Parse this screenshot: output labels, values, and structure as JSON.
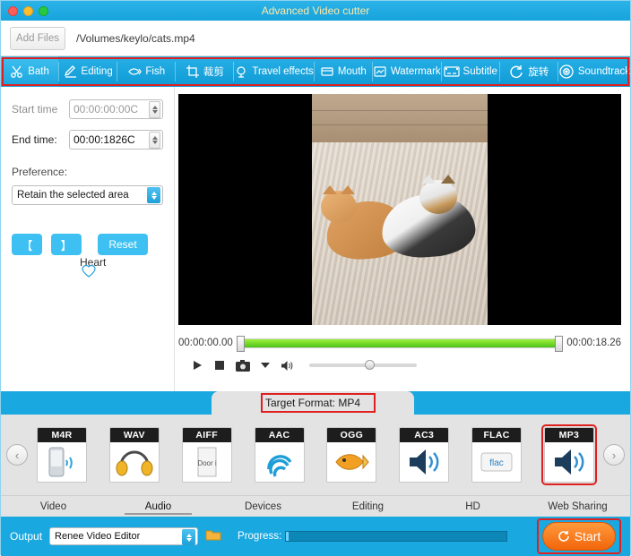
{
  "window": {
    "title": "Advanced Video cutter",
    "traffic_lights": [
      "close",
      "minimize",
      "zoom"
    ]
  },
  "file_row": {
    "add_files_label": "Add Files",
    "file_path": "/Volumes/keylo/cats.mp4"
  },
  "toolbar": {
    "tabs": [
      {
        "label": "Bath",
        "icon": "scissors-icon"
      },
      {
        "label": "Editing",
        "icon": "edit-icon"
      },
      {
        "label": "Fish",
        "icon": "fish-icon"
      },
      {
        "label": "裁剪",
        "icon": "crop-icon"
      },
      {
        "label": "Travel effects",
        "icon": "effects-icon"
      },
      {
        "label": "Mouth",
        "icon": "mouth-icon"
      },
      {
        "label": "Watermark",
        "icon": "watermark-icon"
      },
      {
        "label": "Subtitle",
        "icon": "subtitle-icon"
      },
      {
        "label": "旋转",
        "icon": "rotate-icon"
      },
      {
        "label": "Soundtrack",
        "icon": "soundtrack-icon"
      }
    ]
  },
  "left_panel": {
    "start_time_label": "Start time",
    "start_time_value": "00:00:00:00C",
    "end_time_label": "End time:",
    "end_time_value": "00:00:1826C",
    "preference_label": "Preference:",
    "preference_value": "Retain the selected area",
    "preference_options": [
      "Retain the selected area"
    ],
    "mark_in_label": "【",
    "mark_out_label": "】",
    "reset_label": "Reset",
    "overlay_text": "Heart"
  },
  "player": {
    "current_time": "00:00:00.00",
    "total_time": "00:00:18.26",
    "progress_percent": 100,
    "volume_percent": 52,
    "controls": [
      "play",
      "stop",
      "snapshot",
      "dropdown",
      "volume"
    ]
  },
  "target_format": {
    "label": "Target Format:",
    "value": "MP4"
  },
  "formats": {
    "prev_arrow": "‹",
    "next_arrow": "›",
    "items": [
      {
        "name": "M4R",
        "selected": false,
        "art": "phone-icon"
      },
      {
        "name": "WAV",
        "selected": false,
        "art": "headphones-icon"
      },
      {
        "name": "AIFF",
        "selected": false,
        "art": "door-icon",
        "sub": "Door i"
      },
      {
        "name": "AAC",
        "selected": false,
        "art": "wave-icon"
      },
      {
        "name": "OGG",
        "selected": false,
        "art": "fish-icon"
      },
      {
        "name": "AC3",
        "selected": false,
        "art": "speaker-icon"
      },
      {
        "name": "FLAC",
        "selected": false,
        "art": "flac-icon",
        "sub": "flac"
      },
      {
        "name": "MP3",
        "selected": true,
        "art": "speaker-icon"
      }
    ]
  },
  "category_tabs": [
    {
      "label": "Video",
      "active": false
    },
    {
      "label": "Audio",
      "active": true
    },
    {
      "label": "Devices",
      "active": false
    },
    {
      "label": "Editing",
      "active": false
    },
    {
      "label": "HD",
      "active": false
    },
    {
      "label": "Web Sharing",
      "active": false
    }
  ],
  "bottom": {
    "output_label": "Output",
    "output_value": "Renee Video Editor",
    "folder_icon": "folder-icon",
    "progress_label": "Progress:",
    "progress_percent": 1,
    "start_label": "Start",
    "start_icon": "refresh-icon"
  },
  "colors": {
    "accent_blue": "#1aa8e0",
    "title_text": "#ffe9a8",
    "highlight_red": "#e02020",
    "start_orange": "#f2650a",
    "seek_green": "#4cc21a"
  }
}
